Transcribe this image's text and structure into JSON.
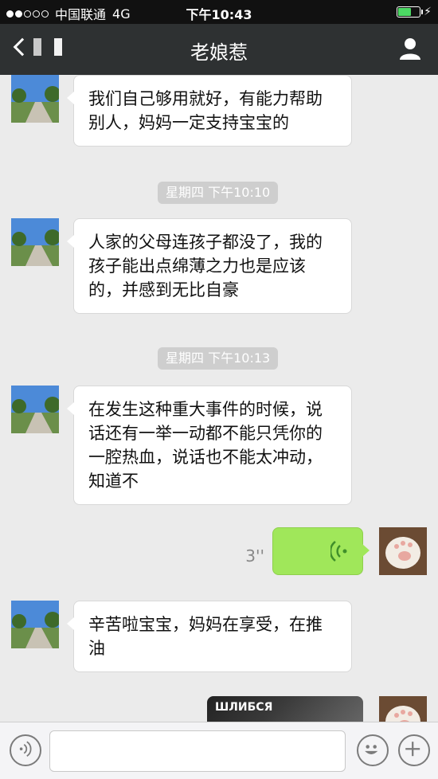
{
  "status_bar": {
    "carrier": "中国联通",
    "network": "4G",
    "time": "下午10:43",
    "signal_dots": [
      1,
      1,
      0,
      0,
      0
    ],
    "battery_level": 0.6
  },
  "nav": {
    "title": "老娘惹",
    "icons": [
      "back-chevron-icon",
      "profile-icon"
    ]
  },
  "messages": [
    {
      "type": "text",
      "side": "left",
      "text": "我们自己够用就好，有能力帮助别人，妈妈一定支持宝宝的"
    },
    {
      "type": "time",
      "text": "星期四 下午10:10"
    },
    {
      "type": "text",
      "side": "left",
      "text": "人家的父母连孩子都没了，我的孩子能出点绵薄之力也是应该的，并感到无比自豪"
    },
    {
      "type": "time",
      "text": "星期四 下午10:13"
    },
    {
      "type": "text",
      "side": "left",
      "text": "在发生这种重大事件的时候，说话还有一举一动都不能只凭你的一腔热血，说话也不能太冲动，知道不"
    },
    {
      "type": "voice",
      "side": "right",
      "duration": "3''"
    },
    {
      "type": "text",
      "side": "left",
      "text": "辛苦啦宝宝，妈妈在享受，在推油"
    },
    {
      "type": "image",
      "side": "right",
      "watermark": "ШЛИБСЯ"
    }
  ],
  "input_bar": {
    "icons": [
      "voice-toggle-icon",
      "emoji-icon",
      "plus-icon"
    ]
  }
}
